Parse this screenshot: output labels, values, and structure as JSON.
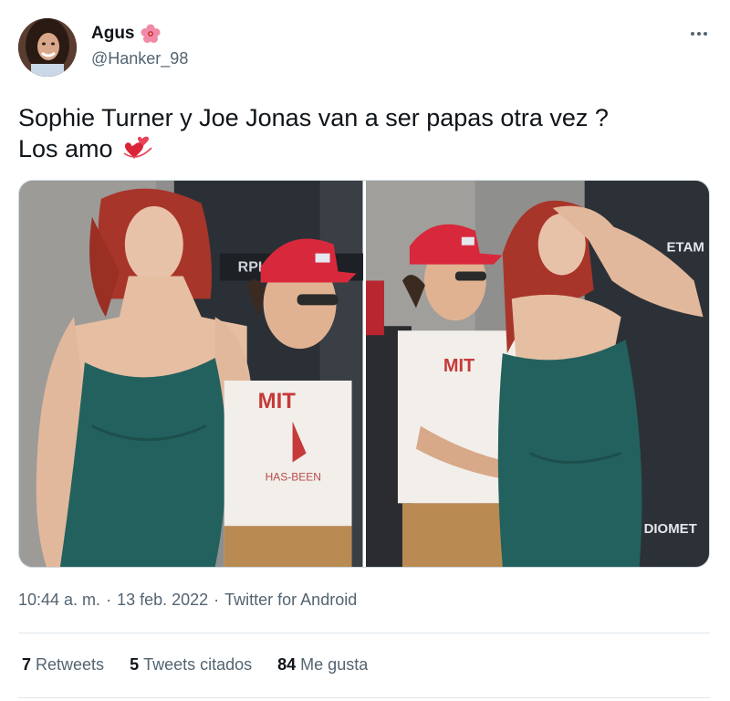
{
  "author": {
    "display_name": "Agus",
    "handle": "@Hanker_98",
    "emoji_icon": "hibiscus-icon"
  },
  "tweet": {
    "text_line1": "Sophie Turner y Joe Jonas van a ser papas otra vez ?",
    "text_line2": "Los amo",
    "emoji_icon": "revolving-hearts-icon"
  },
  "media": {
    "photo1_sign_text": "RPHC",
    "photo2_sign_top": "ETAM",
    "photo2_sign_bottom": "DIOMET",
    "shirt_text": "MIT",
    "shirt_subtext": "HAS-BEEN"
  },
  "meta": {
    "time": "10:44 a. m.",
    "sep1": "·",
    "date": "13 feb. 2022",
    "sep2": "·",
    "source": "Twitter for Android"
  },
  "stats": {
    "retweets_count": "7",
    "retweets_label": "Retweets",
    "quotes_count": "5",
    "quotes_label": "Tweets citados",
    "likes_count": "84",
    "likes_label": "Me gusta"
  },
  "colors": {
    "text": "#0f1419",
    "secondary": "#536471",
    "border": "#cfd9de",
    "dress": "#23615e",
    "cap": "#d8293c",
    "hair": "#a8352a"
  }
}
